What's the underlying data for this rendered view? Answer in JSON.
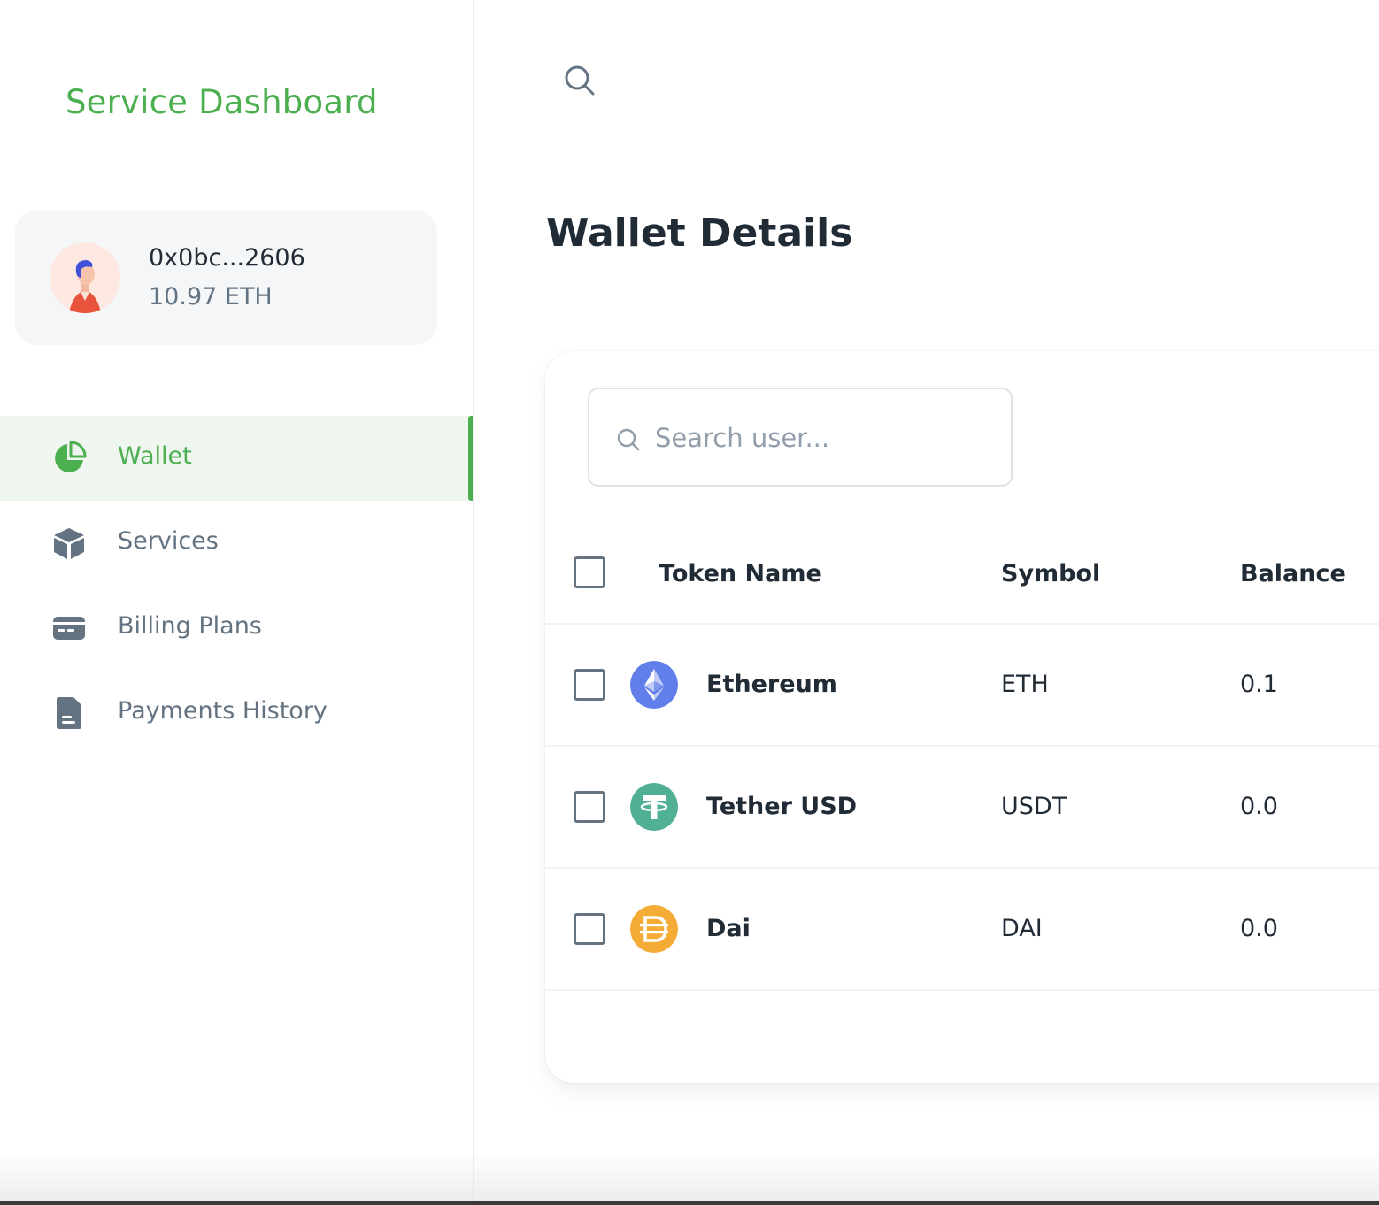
{
  "brand": {
    "title": "Service Dashboard"
  },
  "account": {
    "address": "0x0bc...2606",
    "balance": "10.97 ETH"
  },
  "nav": {
    "items": [
      {
        "label": "Wallet",
        "icon": "pie-chart-icon",
        "active": true
      },
      {
        "label": "Services",
        "icon": "cube-icon",
        "active": false
      },
      {
        "label": "Billing Plans",
        "icon": "credit-card-icon",
        "active": false
      },
      {
        "label": "Payments History",
        "icon": "document-icon",
        "active": false
      }
    ]
  },
  "header": {
    "search_icon": "search-icon"
  },
  "page": {
    "title": "Wallet Details"
  },
  "table": {
    "search_placeholder": "Search user...",
    "columns": [
      "Token Name",
      "Symbol",
      "Balance"
    ],
    "rows": [
      {
        "name": "Ethereum",
        "symbol": "ETH",
        "balance": "0.1",
        "icon": "ethereum-icon",
        "color": "#627eea"
      },
      {
        "name": "Tether USD",
        "symbol": "USDT",
        "balance": "0.0",
        "icon": "tether-icon",
        "color": "#50af95"
      },
      {
        "name": "Dai",
        "symbol": "DAI",
        "balance": "0.0",
        "icon": "dai-icon",
        "color": "#f5ac37"
      }
    ]
  },
  "colors": {
    "accent": "#4caf50",
    "text_primary": "#212b36",
    "text_secondary": "#637381"
  }
}
